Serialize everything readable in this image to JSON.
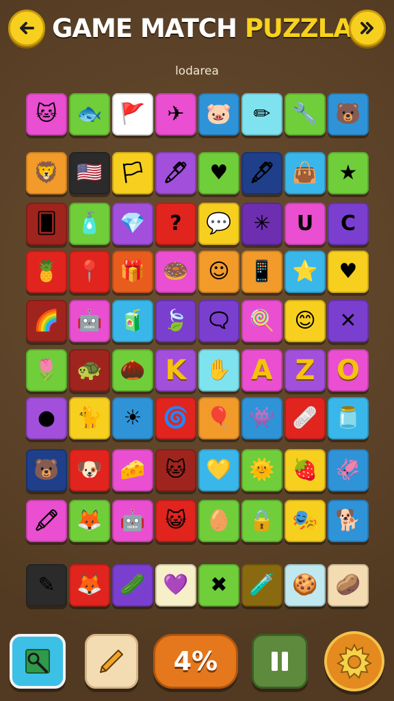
{
  "header": {
    "title_white": "GAME MATCH ",
    "title_yellow": "PUZZLA",
    "back_icon": "arrow-left-icon",
    "next_icon": "skip-forward-icon",
    "subtitle": "lodarea"
  },
  "board": {
    "rows": [
      {
        "tiles": [
          {
            "color": "#e94fd0",
            "icon": "cat-face-icon",
            "glyph": "🐱"
          },
          {
            "color": "#6fce3a",
            "icon": "fish-icon",
            "glyph": "🐟"
          },
          {
            "color": "#ffffff",
            "icon": "flag-icon",
            "glyph": "🚩"
          },
          {
            "color": "#e94fd0",
            "icon": "paper-plane-icon",
            "glyph": "✈"
          },
          {
            "color": "#2f93d8",
            "icon": "pig-icon",
            "glyph": "🐷"
          },
          {
            "color": "#7ee3ef",
            "icon": "pencil-icon",
            "glyph": "✏"
          },
          {
            "color": "#6fce3a",
            "icon": "wrench-icon",
            "glyph": "🔧"
          },
          {
            "color": "#2f93d8",
            "icon": "bear-icon",
            "glyph": "🐻"
          }
        ]
      },
      {
        "tiles": [
          {
            "color": "#f29a2a",
            "icon": "lion-icon",
            "glyph": "🦁"
          },
          {
            "color": "#2b2b2b",
            "icon": "usa-flag-icon",
            "glyph": "🇺🇸"
          },
          {
            "color": "#f7cf1e",
            "icon": "banner-flag-icon",
            "glyph": "🏳"
          },
          {
            "color": "#a24fdc",
            "icon": "marker-icon",
            "glyph": "🖊"
          },
          {
            "color": "#6fce3a",
            "icon": "heart-icon",
            "glyph": "♥"
          },
          {
            "color": "#1f3f8a",
            "icon": "pen-icon",
            "glyph": "🖋"
          },
          {
            "color": "#3ab7ea",
            "icon": "bag-icon",
            "glyph": "👜"
          },
          {
            "color": "#6fce3a",
            "icon": "star-figure-icon",
            "glyph": "★"
          }
        ]
      },
      {
        "tiles": [
          {
            "color": "#a0241e",
            "icon": "card-icon",
            "glyph": "🂠"
          },
          {
            "color": "#6fce3a",
            "icon": "bottle-icon",
            "glyph": "🧴"
          },
          {
            "color": "#a24fdc",
            "icon": "gem-icon",
            "glyph": "💎"
          },
          {
            "color": "#e1241e",
            "icon": "question-hook-icon",
            "glyph": "?"
          },
          {
            "color": "#f7cf1e",
            "icon": "speech-bubble-icon",
            "glyph": "💬"
          },
          {
            "color": "#6d2fb0",
            "icon": "sparkle-icon",
            "glyph": "✳"
          },
          {
            "color": "#e94fd0",
            "icon": "u-box-icon",
            "glyph": "U"
          },
          {
            "color": "#7b3fd0",
            "icon": "letter-c-icon",
            "glyph": "C"
          }
        ]
      },
      {
        "tiles": [
          {
            "color": "#e1241e",
            "icon": "pineapple-icon",
            "glyph": "🍍"
          },
          {
            "color": "#e1241e",
            "icon": "location-pin-icon",
            "glyph": "📍"
          },
          {
            "color": "#e85d1e",
            "icon": "gift-icon",
            "glyph": "🎁"
          },
          {
            "color": "#e94fd0",
            "icon": "donut-icon",
            "glyph": "🍩"
          },
          {
            "color": "#f29a2a",
            "icon": "face-icon",
            "glyph": "☺"
          },
          {
            "color": "#f29a2a",
            "icon": "phone-icon",
            "glyph": "📱"
          },
          {
            "color": "#3ab7ea",
            "icon": "shirt-star-icon",
            "glyph": "⭐"
          },
          {
            "color": "#f7cf1e",
            "icon": "heart-icon",
            "glyph": "♥"
          }
        ]
      },
      {
        "tiles": [
          {
            "color": "#a0241e",
            "icon": "rainbow-card-icon",
            "glyph": "🌈"
          },
          {
            "color": "#e94fd0",
            "icon": "robot-icon",
            "glyph": "🤖"
          },
          {
            "color": "#3ab7ea",
            "icon": "bottle-icon",
            "glyph": "🧃"
          },
          {
            "color": "#7b3fd0",
            "icon": "leaf-icon",
            "glyph": "🍃"
          },
          {
            "color": "#7b3fd0",
            "icon": "chat-icon",
            "glyph": "🗨"
          },
          {
            "color": "#e94fd0",
            "icon": "lollipop-icon",
            "glyph": "🍭"
          },
          {
            "color": "#f7cf1e",
            "icon": "smiley-icon",
            "glyph": "😊"
          },
          {
            "color": "#7b3fd0",
            "icon": "cross-icon",
            "glyph": "✕"
          }
        ]
      },
      {
        "tiles": [
          {
            "color": "#6fce3a",
            "icon": "flower-icon",
            "glyph": "🌷"
          },
          {
            "color": "#a0241e",
            "icon": "turtle-icon",
            "glyph": "🐢"
          },
          {
            "color": "#6fce3a",
            "icon": "acorn-icon",
            "glyph": "🌰"
          },
          {
            "color": "#a24fdc",
            "icon": "letter-k-icon",
            "glyph": "K",
            "letter": true
          },
          {
            "color": "#7ee3ef",
            "icon": "hand-icon",
            "glyph": "✋"
          },
          {
            "color": "#e94fd0",
            "icon": "letter-a-icon",
            "glyph": "A",
            "letter": true
          },
          {
            "color": "#a24fdc",
            "icon": "letter-z-icon",
            "glyph": "Z",
            "letter": true
          },
          {
            "color": "#e94fd0",
            "icon": "letter-o-icon",
            "glyph": "O",
            "letter": true
          }
        ]
      },
      {
        "tiles": [
          {
            "color": "#a24fdc",
            "icon": "button-icon",
            "glyph": "●"
          },
          {
            "color": "#f7cf1e",
            "icon": "cat-icon",
            "glyph": "🐈"
          },
          {
            "color": "#2f93d8",
            "icon": "sun-icon",
            "glyph": "☀"
          },
          {
            "color": "#e1241e",
            "icon": "swirl-icon",
            "glyph": "🌀"
          },
          {
            "color": "#f29a2a",
            "icon": "balloon-icon",
            "glyph": "🎈"
          },
          {
            "color": "#2f93d8",
            "icon": "creature-icon",
            "glyph": "👾"
          },
          {
            "color": "#e1241e",
            "icon": "bandage-icon",
            "glyph": "🩹"
          },
          {
            "color": "#3ab7ea",
            "icon": "jar-icon",
            "glyph": "🫙"
          }
        ]
      },
      {
        "tiles": [
          {
            "color": "#1f3f8a",
            "icon": "bear-face-icon",
            "glyph": "🐻"
          },
          {
            "color": "#e1241e",
            "icon": "dog-face-icon",
            "glyph": "🐶"
          },
          {
            "color": "#e94fd0",
            "icon": "cheese-icon",
            "glyph": "🧀"
          },
          {
            "color": "#a0241e",
            "icon": "cat-face-icon",
            "glyph": "🐱"
          },
          {
            "color": "#3ab7ea",
            "icon": "heart-tag-icon",
            "glyph": "💛"
          },
          {
            "color": "#6fce3a",
            "icon": "sun-icon",
            "glyph": "🌞"
          },
          {
            "color": "#f7cf1e",
            "icon": "strawberry-icon",
            "glyph": "🍓"
          },
          {
            "color": "#2f93d8",
            "icon": "squid-icon",
            "glyph": "🦑"
          }
        ]
      },
      {
        "tiles": [
          {
            "color": "#e94fd0",
            "icon": "crayon-icon",
            "glyph": "🖍"
          },
          {
            "color": "#6fce3a",
            "icon": "fox-icon",
            "glyph": "🦊"
          },
          {
            "color": "#e94fd0",
            "icon": "robot-icon",
            "glyph": "🤖"
          },
          {
            "color": "#e1241e",
            "icon": "cat-face-icon",
            "glyph": "😺"
          },
          {
            "color": "#6fce3a",
            "icon": "egg-face-icon",
            "glyph": "🥚"
          },
          {
            "color": "#6fce3a",
            "icon": "lock-icon",
            "glyph": "🔒"
          },
          {
            "color": "#f7cf1e",
            "icon": "mask-icon",
            "glyph": "🎭"
          },
          {
            "color": "#2f93d8",
            "icon": "dog-icon",
            "glyph": "🐕"
          }
        ]
      },
      {
        "tiles": [
          {
            "color": "#2b2b2b",
            "icon": "pencil-icon",
            "glyph": "✎"
          },
          {
            "color": "#e1241e",
            "icon": "fox-head-icon",
            "glyph": "🦊"
          },
          {
            "color": "#7b3fd0",
            "icon": "cucumber-icon",
            "glyph": "🥒"
          },
          {
            "color": "#f6efc8",
            "icon": "heart-face-icon",
            "glyph": "💜"
          },
          {
            "color": "#6fce3a",
            "icon": "bandage-x-icon",
            "glyph": "✖"
          },
          {
            "color": "#8a6a10",
            "icon": "potion-icon",
            "glyph": "🧪"
          },
          {
            "color": "#bfe8ef",
            "icon": "gingerbread-icon",
            "glyph": "🍪"
          },
          {
            "color": "#f4dcb2",
            "icon": "potato-icon",
            "glyph": "🥔"
          }
        ]
      }
    ]
  },
  "controls": {
    "hint_icon": "magnifier-map-icon",
    "pencil_icon": "pencil-icon",
    "progress_label": "4%",
    "pause_icon": "pause-icon",
    "settings_icon": "gear-icon"
  }
}
